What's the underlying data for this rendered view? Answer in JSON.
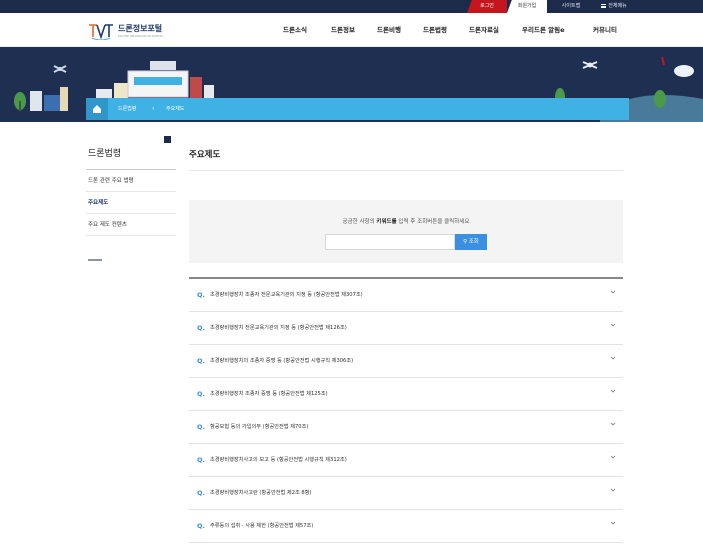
{
  "util": {
    "login": "로그인",
    "join": "회원가입",
    "sitemap": "사이트맵",
    "all_menu": "전체메뉴"
  },
  "logo": {
    "title": "드론정보포털",
    "subtitle": "DRONE INFORMATION PORTAL"
  },
  "gnb": [
    "드론소식",
    "드론정보",
    "드론비행",
    "드론법령",
    "드론자료실",
    "우리드론 알림e",
    "커뮤니티"
  ],
  "breadcrumb": {
    "home_icon": "home-icon",
    "items": [
      "드론법령",
      "주요제도"
    ]
  },
  "sidebar": {
    "title": "드론법령",
    "items": [
      {
        "label": "드론 관련 주요 법령",
        "active": false
      },
      {
        "label": "주요제도",
        "active": true
      },
      {
        "label": "주요 제도 컨텐츠",
        "active": false
      }
    ]
  },
  "page_title": "주요제도",
  "search": {
    "guide_pre": "궁금한 사항의 ",
    "guide_bold": "키워드를",
    "guide_post": " 입력 후 조회버튼을 클릭하세요",
    "placeholder": "",
    "button": "조회"
  },
  "faq_marker": "Q.",
  "faq": [
    "초경량비행장치 조종자 전문교육기관의 지정 등 (항공안전법 제307조)",
    "초경량비행장치 전문교육기관의 지정 등 (항공안전법 제126조)",
    "초경량비행장치의 조종자 증명 등 (항공안전법 시행규칙 제306조)",
    "초경량비행장치 조종자 증명 등 (항공안전법 제125조)",
    "항공보험 등의 가입의무 (항공안전법 제70조)",
    "초경량비행장치사고의 보고 등 (항공안전법 시행규칙 제312조)",
    "초경량비행장치사고란 (항공안전법 제2조 8항)",
    "주류등의 섭취 · 사용 제한 (항공안전법 제57조)"
  ],
  "colors": {
    "navy": "#1d2b4a",
    "accent_blue": "#3fb1e5",
    "button_blue": "#3a8fe0",
    "login_red": "#c4161c"
  }
}
